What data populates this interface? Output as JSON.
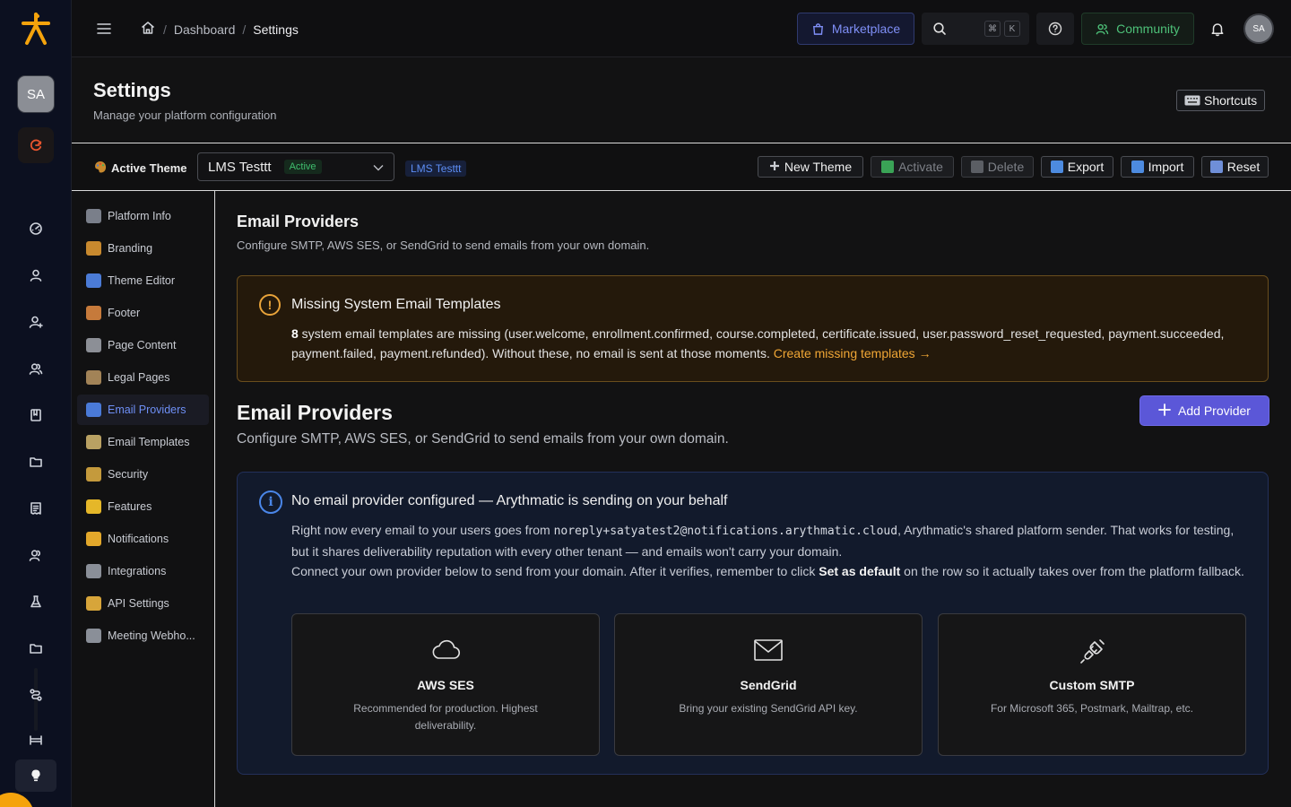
{
  "rail": {
    "user_initials": "SA"
  },
  "topbar": {
    "breadcrumb": [
      "Dashboard",
      "Settings"
    ],
    "marketplace_label": "Marketplace",
    "search_shortcut": [
      "⌘",
      "K"
    ],
    "community_label": "Community",
    "avatar_initials": "SA"
  },
  "page": {
    "title": "Settings",
    "subtitle": "Manage your platform configuration",
    "shortcuts_label": "Shortcuts"
  },
  "theme_bar": {
    "label": "Active Theme",
    "selected_theme": "LMS Testtt",
    "selected_badge": "Active",
    "theme_tag": "LMS Testtt",
    "buttons": {
      "new_theme": "New Theme",
      "activate": "Activate",
      "delete": "Delete",
      "export": "Export",
      "import": "Import",
      "reset": "Reset"
    }
  },
  "settings_nav": {
    "items": [
      {
        "label": "Platform Info",
        "icon": "building-icon",
        "color": "#7a7f8a"
      },
      {
        "label": "Branding",
        "icon": "palette-icon",
        "color": "#c8892e"
      },
      {
        "label": "Theme Editor",
        "icon": "brush-icon",
        "color": "#4b7bd6"
      },
      {
        "label": "Footer",
        "icon": "footprint-icon",
        "color": "#c67a3b"
      },
      {
        "label": "Page Content",
        "icon": "page-icon",
        "color": "#8c8f96"
      },
      {
        "label": "Legal Pages",
        "icon": "scroll-icon",
        "color": "#a28357"
      },
      {
        "label": "Email Providers",
        "icon": "email-icon",
        "color": "#4a7ad8",
        "active": true
      },
      {
        "label": "Email Templates",
        "icon": "memo-icon",
        "color": "#b9a163"
      },
      {
        "label": "Security",
        "icon": "lock-icon",
        "color": "#c49a3c"
      },
      {
        "label": "Features",
        "icon": "lightning-icon",
        "color": "#e5b729"
      },
      {
        "label": "Notifications",
        "icon": "bell-icon",
        "color": "#e3a82b"
      },
      {
        "label": "Integrations",
        "icon": "link-icon",
        "color": "#8a8f98"
      },
      {
        "label": "API Settings",
        "icon": "key-icon",
        "color": "#d7a53a"
      },
      {
        "label": "Meeting Webho...",
        "icon": "link-icon",
        "color": "#8a8f98"
      }
    ]
  },
  "main": {
    "section_title": "Email Providers",
    "section_subtitle": "Configure SMTP, AWS SES, or SendGrid to send emails from your own domain.",
    "warning": {
      "title": "Missing System Email Templates",
      "count": "8",
      "text": " system email templates are missing (user.welcome, enrollment.confirmed, course.completed, certificate.issued, user.password_reset_requested, payment.succeeded, payment.failed, payment.refunded). Without these, no email is sent at those moments. ",
      "link": "Create missing templates →"
    },
    "providers_title": "Email Providers",
    "providers_subtitle": "Configure SMTP, AWS SES, or SendGrid to send emails from your own domain.",
    "add_provider_label": "Add Provider",
    "info": {
      "title": "No email provider configured — Arythmatic is sending on your behalf",
      "line1_pre": "Right now every email to your users goes from ",
      "sender": "noreply+satyatest2@notifications.arythmatic.cloud",
      "line1_post": ", Arythmatic's shared platform sender. That works for testing, but it shares deliverability reputation with every other tenant — and emails won't carry your domain.",
      "line2_pre": "Connect your own provider below to send from your domain. After it verifies, remember to click ",
      "line2_bold": "Set as default",
      "line2_post": " on the row so it actually takes over from the platform fallback."
    },
    "provider_cards": [
      {
        "name": "AWS SES",
        "description": "Recommended for production. Highest deliverability.",
        "icon": "cloud-icon"
      },
      {
        "name": "SendGrid",
        "description": "Bring your existing SendGrid API key.",
        "icon": "envelope-icon"
      },
      {
        "name": "Custom SMTP",
        "description": "For Microsoft 365, Postmark, Mailtrap, etc.",
        "icon": "plug-icon"
      }
    ]
  }
}
